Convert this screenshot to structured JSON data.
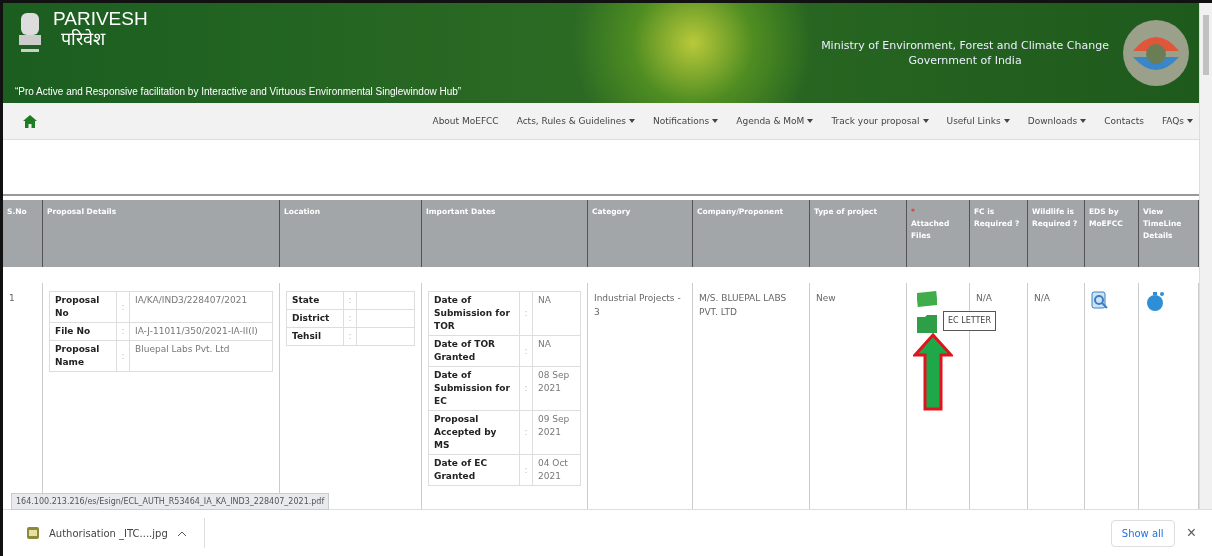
{
  "header": {
    "name_en": "PARIVESH",
    "name_hi": "परिवेश",
    "tagline": "“Pro Active and Responsive facilitation by Interactive and Virtuous Environmental Singlewindow Hub”",
    "ministry": "Ministry of Environment, Forest and Climate Change",
    "government": "Government of India"
  },
  "nav": [
    {
      "label": "About MoEFCC",
      "dropdown": false
    },
    {
      "label": "Acts, Rules & Guidelines",
      "dropdown": true
    },
    {
      "label": "Notifications",
      "dropdown": true
    },
    {
      "label": "Agenda & MoM",
      "dropdown": true
    },
    {
      "label": "Track your proposal",
      "dropdown": true
    },
    {
      "label": "Useful Links",
      "dropdown": true
    },
    {
      "label": "Downloads",
      "dropdown": true
    },
    {
      "label": "Contacts",
      "dropdown": false
    },
    {
      "label": "FAQs",
      "dropdown": true
    }
  ],
  "table": {
    "columns": [
      {
        "label": "S.No"
      },
      {
        "label": "Proposal Details"
      },
      {
        "label": "Location"
      },
      {
        "label": "Important Dates"
      },
      {
        "label": "Category"
      },
      {
        "label": "Company/Proponent"
      },
      {
        "label": "Type of project"
      },
      {
        "label": "Attached Files",
        "marker": "*"
      },
      {
        "label": "FC is Required ?"
      },
      {
        "label": "Wildlife is Required ?"
      },
      {
        "label": "EDS by MoEFCC"
      },
      {
        "label": "View TimeLine Details"
      }
    ],
    "rows": [
      {
        "sno": "1",
        "proposal_details": [
          {
            "label": "Proposal No",
            "sep": ":",
            "value": "IA/KA/IND3/228407/2021"
          },
          {
            "label": "File No",
            "sep": ":",
            "value": "IA-J-11011/350/2021-IA-II(I)"
          },
          {
            "label": "Proposal Name",
            "sep": ":",
            "value": "Bluepal Labs Pvt. Ltd"
          }
        ],
        "location": [
          {
            "label": "State",
            "sep": ":"
          },
          {
            "label": "District",
            "sep": ":"
          },
          {
            "label": "Tehsil",
            "sep": ":"
          }
        ],
        "dates": [
          {
            "label": "Date of Submission for TOR",
            "sep": ":",
            "value": "NA"
          },
          {
            "label": "Date of TOR Granted",
            "sep": ":",
            "value": "NA"
          },
          {
            "label": "Date of Submission for EC",
            "sep": ":",
            "value": "08 Sep 2021"
          },
          {
            "label": "Proposal Accepted by MS",
            "sep": ":",
            "value": "09 Sep 2021"
          },
          {
            "label": "Date of EC Granted",
            "sep": ":",
            "value": "04 Oct 2021"
          }
        ],
        "category": "Industrial Projects - 3",
        "company": "M/S. BLUEPAL LABS PVT. LTD",
        "type": "New",
        "tooltip": "EC LETTER",
        "fc_required": "N/A",
        "wildlife_required": "N/A"
      }
    ]
  },
  "status_url": "164.100.213.216/es/Esign/ECL_AUTH_R53464_IA_KA_IND3_228407_2021.pdf",
  "download_bar": {
    "file": "Authorisation _ITC....jpg",
    "show_all": "Show all",
    "close": "×"
  }
}
